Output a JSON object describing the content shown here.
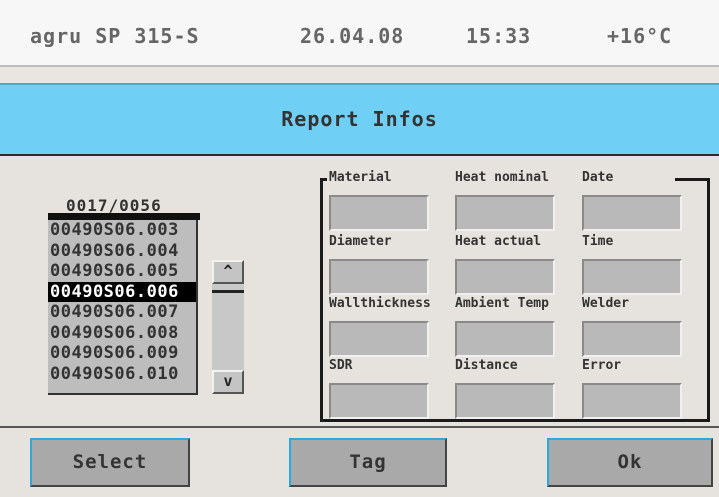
{
  "status": {
    "device": "agru SP 315-S",
    "date": "26.04.08",
    "time": "15:33",
    "temperature": "+16°C"
  },
  "title": "Report Infos",
  "list": {
    "header": "0017/0056",
    "items": [
      "00490S06.003",
      "00490S06.004",
      "00490S06.005",
      "00490S06.006",
      "00490S06.007",
      "00490S06.008",
      "00490S06.009",
      "00490S06.010"
    ],
    "selected_index": 3,
    "scroll_up_glyph": "^",
    "scroll_down_glyph": "v"
  },
  "fields": [
    {
      "label": "Material",
      "value": ""
    },
    {
      "label": "Heat nominal",
      "value": ""
    },
    {
      "label": "Date",
      "value": ""
    },
    {
      "label": "Diameter",
      "value": ""
    },
    {
      "label": "Heat actual",
      "value": ""
    },
    {
      "label": "Time",
      "value": ""
    },
    {
      "label": "Wallthickness",
      "value": ""
    },
    {
      "label": "Ambient Temp",
      "value": ""
    },
    {
      "label": "Welder",
      "value": ""
    },
    {
      "label": "SDR",
      "value": ""
    },
    {
      "label": "Distance",
      "value": ""
    },
    {
      "label": "Error",
      "value": ""
    }
  ],
  "buttons": {
    "select": "Select",
    "tag": "Tag",
    "ok": "Ok"
  },
  "colors": {
    "title_bar": "#6fcff5",
    "button_face": "#a9a9a9",
    "button_accent": "#2aa9df",
    "selected_row": "#000000"
  }
}
